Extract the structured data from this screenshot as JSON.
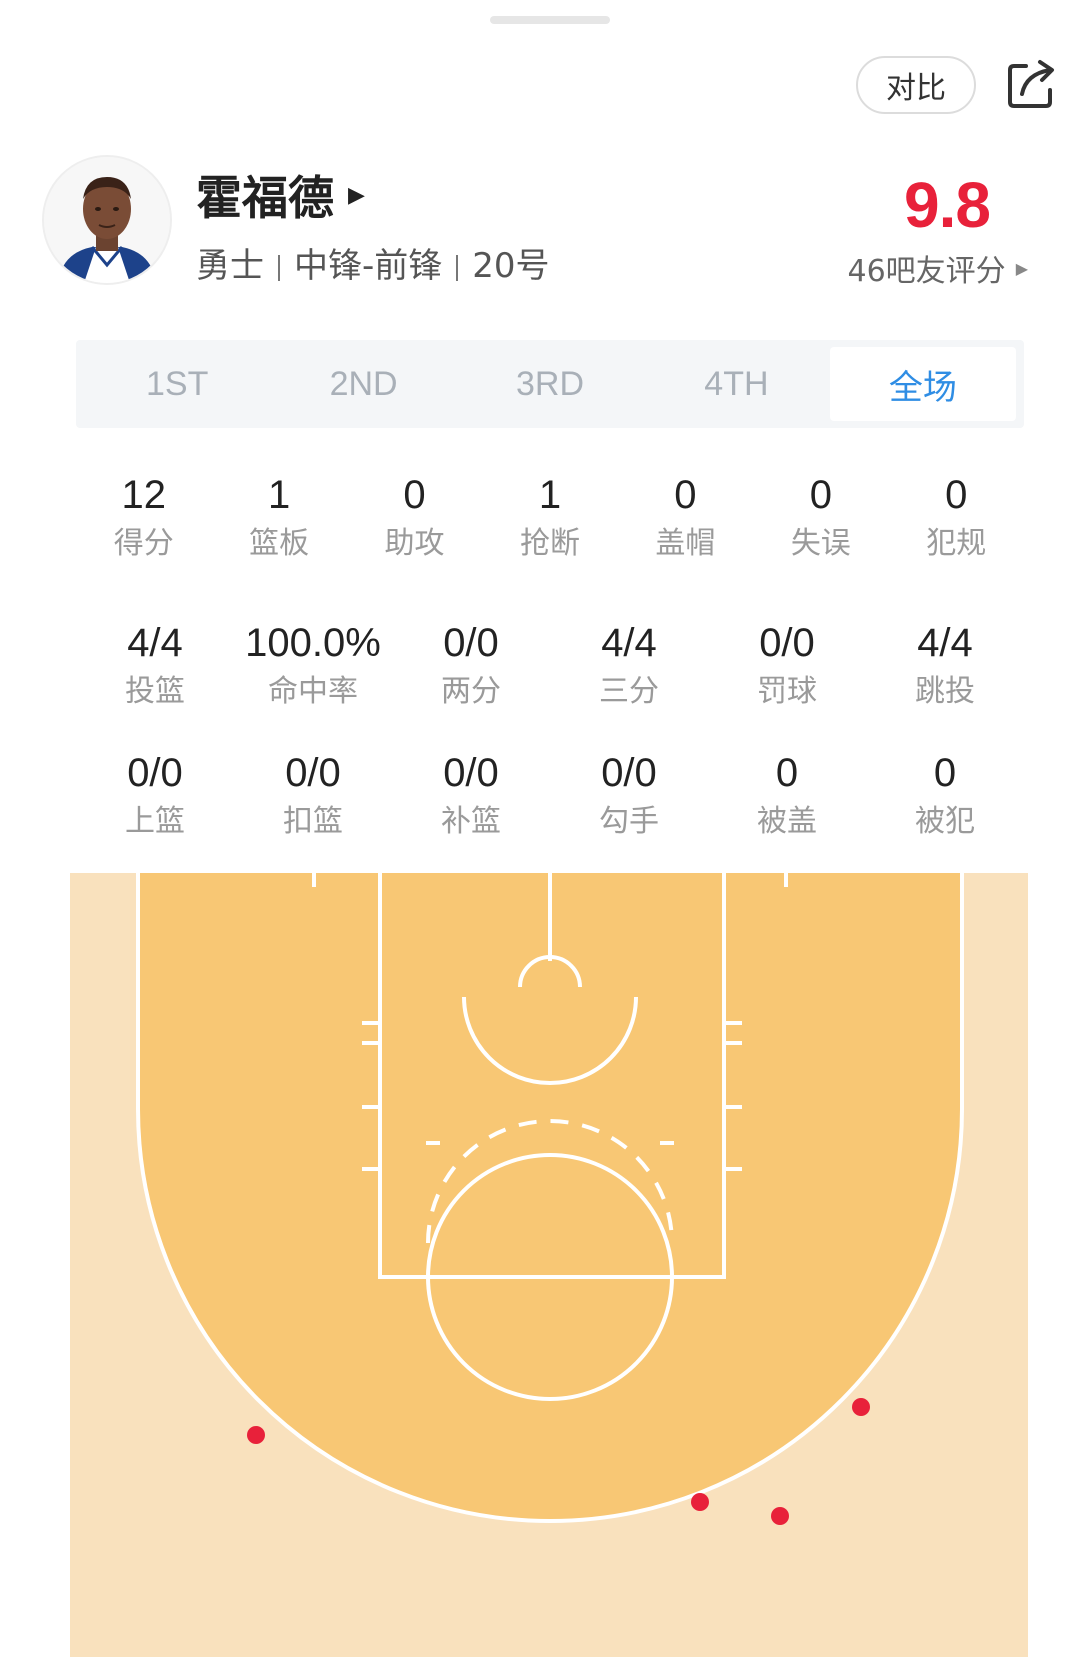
{
  "header": {
    "compare_label": "对比",
    "share_icon": "share-icon"
  },
  "player": {
    "name": "霍福德",
    "team": "勇士",
    "position": "中锋-前锋",
    "number": "20号",
    "rating": "9.8",
    "rating_count": "46吧友评分"
  },
  "tabs": [
    {
      "label": "1ST",
      "active": false
    },
    {
      "label": "2ND",
      "active": false
    },
    {
      "label": "3RD",
      "active": false
    },
    {
      "label": "4TH",
      "active": false
    },
    {
      "label": "全场",
      "active": true
    }
  ],
  "stats_basic": [
    {
      "value": "12",
      "label": "得分"
    },
    {
      "value": "1",
      "label": "篮板"
    },
    {
      "value": "0",
      "label": "助攻"
    },
    {
      "value": "1",
      "label": "抢断"
    },
    {
      "value": "0",
      "label": "盖帽"
    },
    {
      "value": "0",
      "label": "失误"
    },
    {
      "value": "0",
      "label": "犯规"
    }
  ],
  "stats_shooting": [
    {
      "value": "4/4",
      "label": "投篮"
    },
    {
      "value": "100.0%",
      "label": "命中率"
    },
    {
      "value": "0/0",
      "label": "两分"
    },
    {
      "value": "4/4",
      "label": "三分"
    },
    {
      "value": "0/0",
      "label": "罚球"
    },
    {
      "value": "4/4",
      "label": "跳投"
    }
  ],
  "stats_detail": [
    {
      "value": "0/0",
      "label": "上篮"
    },
    {
      "value": "0/0",
      "label": "扣篮"
    },
    {
      "value": "0/0",
      "label": "补篮"
    },
    {
      "value": "0/0",
      "label": "勾手"
    },
    {
      "value": "0",
      "label": "被盖"
    },
    {
      "value": "0",
      "label": "被犯"
    }
  ],
  "shot_chart": {
    "court_inside_color": "#f8c774",
    "court_outside_color": "#f9e1bd",
    "made_shot_color": "#e8213a",
    "made_shots": 4
  }
}
